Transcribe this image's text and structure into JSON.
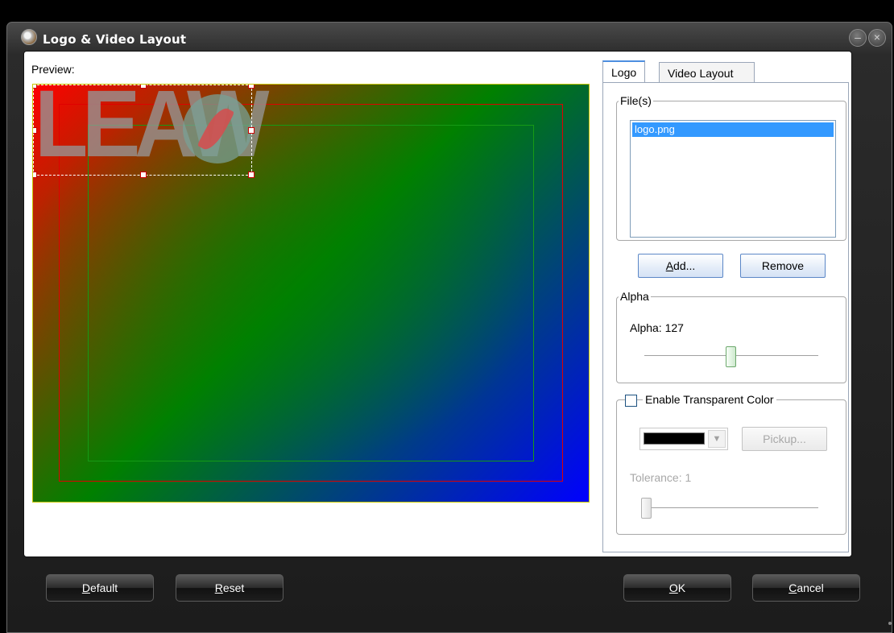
{
  "window": {
    "title": "Logo & Video Layout",
    "minimize_glyph": "–",
    "close_glyph": "×"
  },
  "preview": {
    "label": "Preview:",
    "logo_text": "LEAW",
    "canvas_gradient": [
      "#ff0000",
      "#008000",
      "#0000ff"
    ]
  },
  "tabs": [
    {
      "label": "Logo",
      "active": true
    },
    {
      "label": "Video Layout",
      "active": false
    }
  ],
  "files_group": {
    "label": "File(s)",
    "items": [
      "logo.png"
    ],
    "selected": "logo.png"
  },
  "buttons": {
    "add": "Add...",
    "remove": "Remove",
    "pickup": "Pickup..."
  },
  "alpha_group": {
    "label": "Alpha",
    "value_label": "Alpha: 127",
    "value": 127,
    "max": 255
  },
  "transparent_group": {
    "checkbox_label": "Enable Transparent Color",
    "checked": false,
    "color": "#000000",
    "tolerance_label": "Tolerance: 1",
    "tolerance": 1
  },
  "footer": {
    "default": "Default",
    "reset": "Reset",
    "ok": "OK",
    "cancel": "Cancel"
  }
}
